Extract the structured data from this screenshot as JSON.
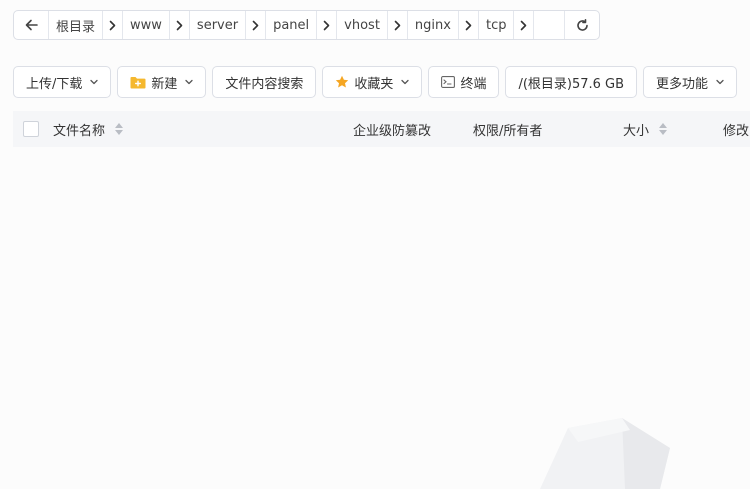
{
  "breadcrumb": {
    "segments": [
      "根目录",
      "www",
      "server",
      "panel",
      "vhost",
      "nginx",
      "tcp"
    ]
  },
  "toolbar": {
    "upload_download": "上传/下载",
    "new": "新建",
    "content_search": "文件内容搜索",
    "favorites": "收藏夹",
    "terminal": "终端",
    "disk": "/(根目录)57.6 GB",
    "more": "更多功能"
  },
  "table": {
    "headers": {
      "name": "文件名称",
      "tamper": "企业级防篡改",
      "permission": "权限/所有者",
      "size": "大小",
      "modified": "修改时间"
    }
  },
  "colors": {
    "folder": "#f5b82e",
    "star": "#f5a623",
    "border": "#dcdfe6",
    "header_bg": "#f5f6f8"
  },
  "icons": [
    "arrow-left-icon",
    "chevron-right-icon",
    "refresh-icon",
    "folder-plus-icon",
    "star-icon",
    "terminal-icon",
    "chevron-down-icon",
    "sort-icon"
  ]
}
